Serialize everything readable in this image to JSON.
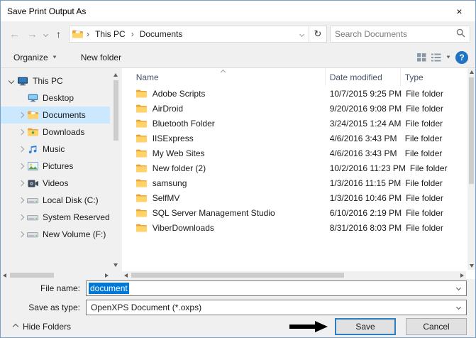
{
  "window": {
    "title": "Save Print Output As",
    "close_glyph": "×"
  },
  "nav": {
    "back_glyph": "←",
    "forward_glyph": "→",
    "up_glyph": "↑",
    "refresh_glyph": "↻",
    "crumb_separator": "›",
    "breadcrumb": [
      "This PC",
      "Documents"
    ],
    "search_placeholder": "Search Documents"
  },
  "toolbar": {
    "organize_label": "Organize",
    "new_folder_label": "New folder",
    "help_glyph": "?"
  },
  "sidebar": {
    "items": [
      {
        "label": "This PC",
        "icon": "pc",
        "level": 0,
        "expanded": true,
        "has_children": true,
        "selected": false
      },
      {
        "label": "Desktop",
        "icon": "desktop",
        "level": 1,
        "expanded": false,
        "has_children": false,
        "selected": false
      },
      {
        "label": "Documents",
        "icon": "documents",
        "level": 1,
        "expanded": false,
        "has_children": true,
        "selected": true
      },
      {
        "label": "Downloads",
        "icon": "downloads",
        "level": 1,
        "expanded": false,
        "has_children": true,
        "selected": false
      },
      {
        "label": "Music",
        "icon": "music",
        "level": 1,
        "expanded": false,
        "has_children": true,
        "selected": false
      },
      {
        "label": "Pictures",
        "icon": "pictures",
        "level": 1,
        "expanded": false,
        "has_children": true,
        "selected": false
      },
      {
        "label": "Videos",
        "icon": "videos",
        "level": 1,
        "expanded": false,
        "has_children": true,
        "selected": false
      },
      {
        "label": "Local Disk (C:)",
        "icon": "disk",
        "level": 1,
        "expanded": false,
        "has_children": true,
        "selected": false
      },
      {
        "label": "System Reserved",
        "icon": "disk",
        "level": 1,
        "expanded": false,
        "has_children": true,
        "selected": false
      },
      {
        "label": "New Volume (F:)",
        "icon": "disk",
        "level": 1,
        "expanded": false,
        "has_children": true,
        "selected": false
      }
    ]
  },
  "file_list": {
    "columns": [
      "Name",
      "Date modified",
      "Type"
    ],
    "sort": {
      "column": "Name",
      "direction": "ascending"
    },
    "rows": [
      {
        "name": "Adobe Scripts",
        "date_modified": "10/7/2015 9:25 PM",
        "type": "File folder"
      },
      {
        "name": "AirDroid",
        "date_modified": "9/20/2016 9:08 PM",
        "type": "File folder"
      },
      {
        "name": "Bluetooth Folder",
        "date_modified": "3/24/2015 1:24 AM",
        "type": "File folder"
      },
      {
        "name": "IISExpress",
        "date_modified": "4/6/2016 3:43 PM",
        "type": "File folder"
      },
      {
        "name": "My Web Sites",
        "date_modified": "4/6/2016 3:43 PM",
        "type": "File folder"
      },
      {
        "name": "New folder (2)",
        "date_modified": "10/2/2016 11:23 PM",
        "type": "File folder"
      },
      {
        "name": "samsung",
        "date_modified": "1/3/2016 11:15 PM",
        "type": "File folder"
      },
      {
        "name": "SelfMV",
        "date_modified": "1/3/2016 10:46 PM",
        "type": "File folder"
      },
      {
        "name": "SQL Server Management Studio",
        "date_modified": "6/10/2016 2:19 PM",
        "type": "File folder"
      },
      {
        "name": "ViberDownloads",
        "date_modified": "8/31/2016 8:03 PM",
        "type": "File folder"
      }
    ]
  },
  "fields": {
    "file_name_label": "File name:",
    "file_name_value": "document",
    "file_name_selected": true,
    "save_as_type_label": "Save as type:",
    "save_as_type_value": "OpenXPS Document (*.oxps)"
  },
  "footer": {
    "hide_folders_label": "Hide Folders",
    "save_label": "Save",
    "cancel_label": "Cancel"
  },
  "colors": {
    "accent": "#0078d7",
    "selection_highlight": "#cce8ff",
    "folder_yellow": "#ffd368",
    "help_button_blue": "#2173c4",
    "annotation_arrow": "#000000"
  }
}
